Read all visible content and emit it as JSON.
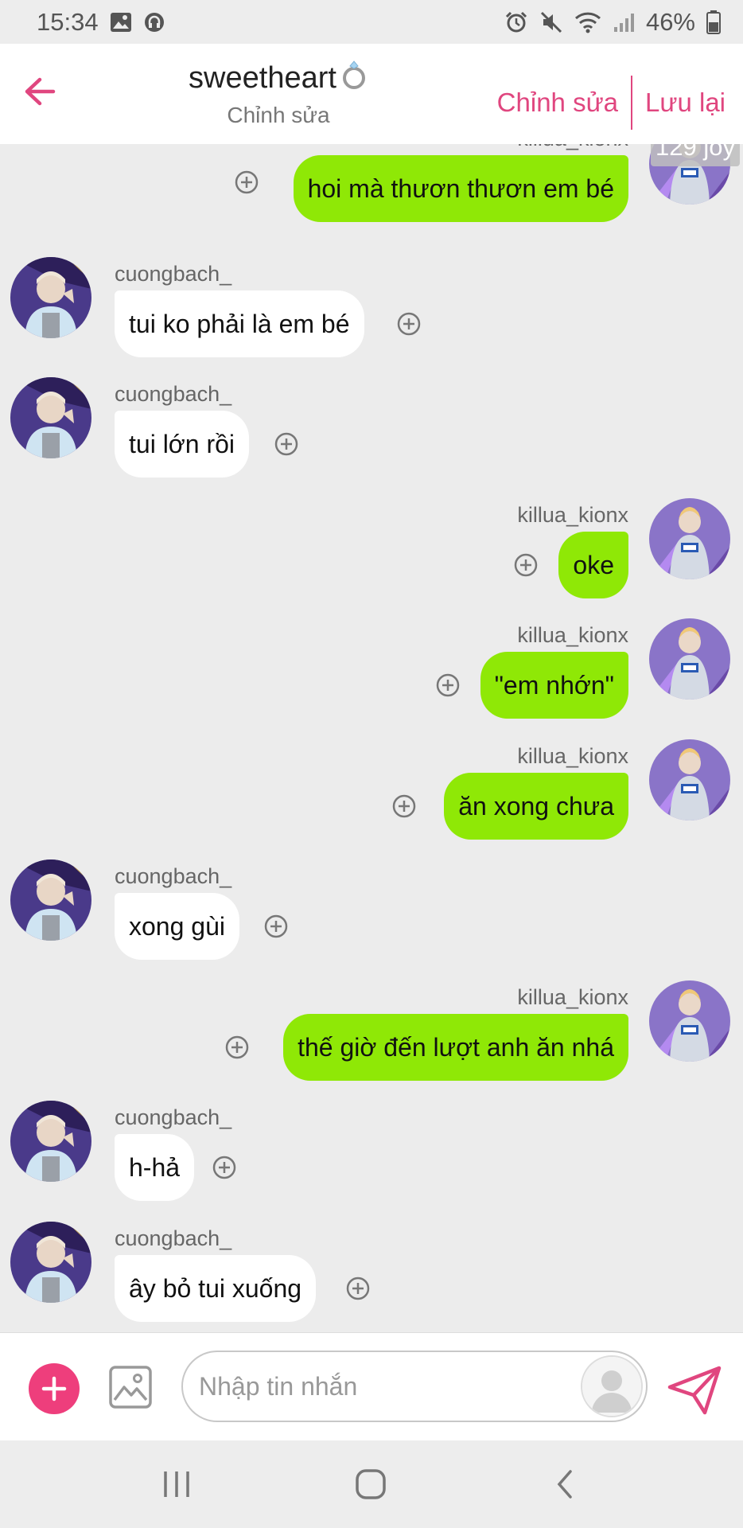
{
  "status_bar": {
    "time": "15:34",
    "battery": "46%",
    "left_icons": [
      "image-icon",
      "headphones-icon"
    ],
    "right_icons": [
      "alarm-icon",
      "mute-icon",
      "wifi-icon",
      "signal-icon",
      "battery-icon"
    ]
  },
  "header": {
    "title": "sweetheart",
    "title_icon": "ring-icon",
    "subtitle": "Chỉnh sửa",
    "edit_label": "Chỉnh sửa",
    "save_label": "Lưu lại",
    "accent_color": "#e0467f"
  },
  "colors": {
    "outgoing_bubble": "#8fe806",
    "incoming_bubble": "#ffffff",
    "chat_background": "#ececec",
    "plus_button": "#ee3e7c"
  },
  "messages": [
    {
      "side": "out",
      "user": "killua_kionx",
      "text": "hoi mà thươn thươn em bé",
      "badge": "129 joy"
    },
    {
      "side": "in",
      "user": "cuongbach_",
      "text": "tui ko phải là em bé"
    },
    {
      "side": "in",
      "user": "cuongbach_",
      "text": "tui lớn rồi"
    },
    {
      "side": "out",
      "user": "killua_kionx",
      "text": "oke"
    },
    {
      "side": "out",
      "user": "killua_kionx",
      "text": "\"em nhớn\""
    },
    {
      "side": "out",
      "user": "killua_kionx",
      "text": "ăn xong chưa"
    },
    {
      "side": "in",
      "user": "cuongbach_",
      "text": "xong gùi"
    },
    {
      "side": "out",
      "user": "killua_kionx",
      "text": "thế giờ đến lượt anh ăn nhá"
    },
    {
      "side": "in",
      "user": "cuongbach_",
      "text": "h-hả"
    },
    {
      "side": "in",
      "user": "cuongbach_",
      "text": "ây bỏ tui xuống"
    }
  ],
  "input": {
    "placeholder": "Nhập tin nhắn",
    "value": ""
  },
  "nav": {
    "recents_icon": "recents-icon",
    "home_icon": "home-icon",
    "back_icon": "back-icon"
  }
}
